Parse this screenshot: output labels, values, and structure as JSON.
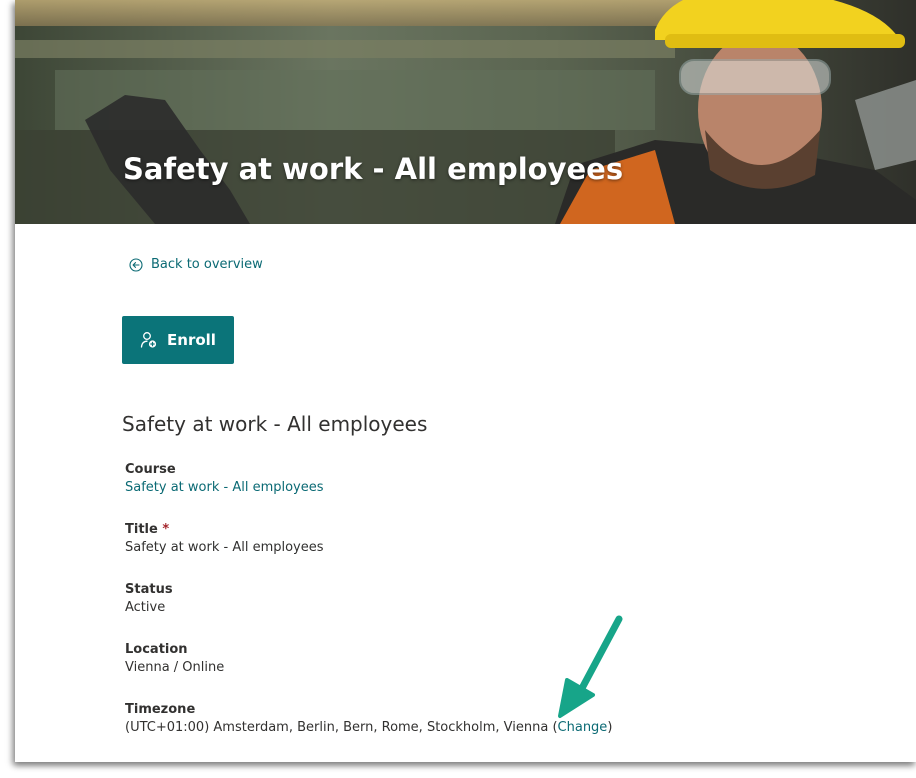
{
  "hero": {
    "title": "Safety at work - All employees"
  },
  "nav": {
    "back_label": "Back to overview"
  },
  "actions": {
    "enroll_label": "Enroll"
  },
  "details": {
    "heading": "Safety at work - All employees",
    "course": {
      "label": "Course",
      "value": "Safety at work - All employees"
    },
    "title": {
      "label": "Title",
      "required_mark": "*",
      "value": "Safety at work - All employees"
    },
    "status": {
      "label": "Status",
      "value": "Active"
    },
    "location": {
      "label": "Location",
      "value": "Vienna / Online"
    },
    "timezone": {
      "label": "Timezone",
      "value": "(UTC+01:00) Amsterdam, Berlin, Bern, Rome, Stockholm, Vienna (",
      "change_label": "Change",
      "suffix": ")"
    }
  },
  "colors": {
    "accent": "#0b7479",
    "link": "#0b6a74",
    "annotation_arrow": "#17a589"
  },
  "icons": {
    "back": "circle-arrow-left-icon",
    "enroll": "person-add-icon"
  }
}
